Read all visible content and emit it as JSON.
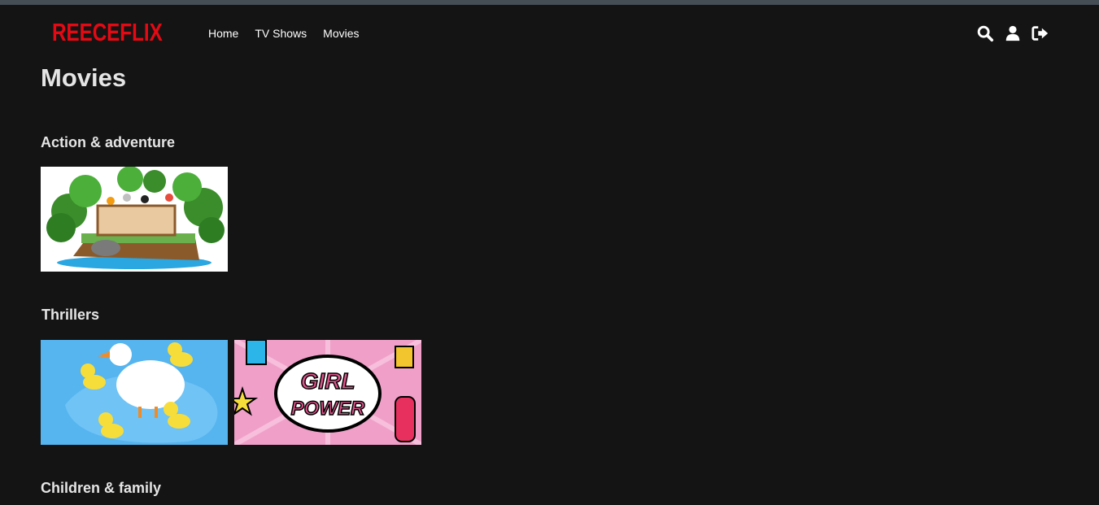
{
  "brand": {
    "logo_text": "REECEFLIX",
    "color": "#e50914"
  },
  "nav": {
    "links": [
      {
        "label": "Home"
      },
      {
        "label": "TV Shows"
      },
      {
        "label": "Movies"
      }
    ],
    "icons": [
      "search-icon",
      "user-icon",
      "sign-out-icon"
    ]
  },
  "page": {
    "title": "Movies"
  },
  "rows": [
    {
      "title": "Action & adventure",
      "tiles": [
        {
          "name": "jungle-island-thumbnail"
        }
      ]
    },
    {
      "title": "Thrillers",
      "tiles": [
        {
          "name": "ducks-thumbnail"
        },
        {
          "name": "girl-power-thumbnail",
          "text_1": "GIRL",
          "text_2": "POWER"
        }
      ]
    },
    {
      "title": "Children & family",
      "tiles": []
    }
  ],
  "colors": {
    "background": "#141414",
    "topbar": "#454d55",
    "text": "#e5e5e5"
  }
}
